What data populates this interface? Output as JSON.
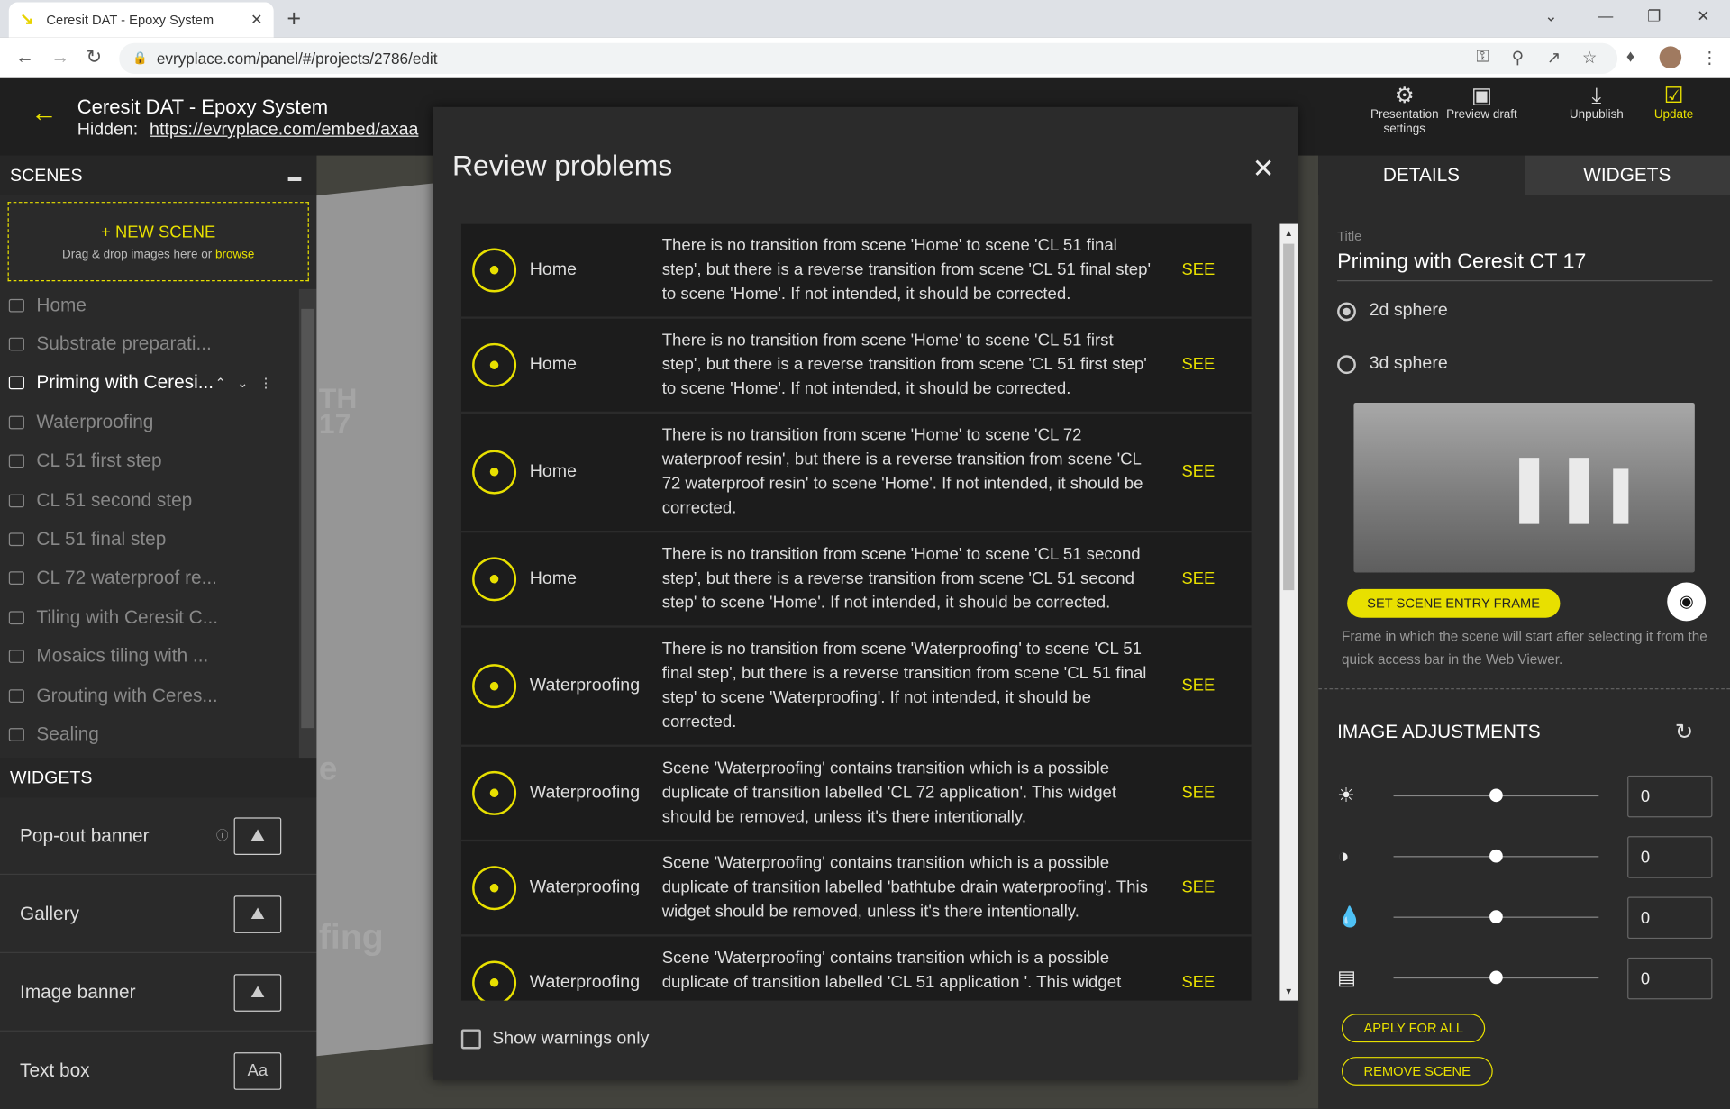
{
  "browser": {
    "tab_title": "Ceresit DAT - Epoxy System",
    "url": "evryplace.com/panel/#/projects/2786/edit"
  },
  "header": {
    "project_title": "Ceresit DAT - Epoxy System",
    "hidden_label": "Hidden:",
    "hidden_link": "https://evryplace.com/embed/axaa",
    "buttons": {
      "presentation_settings": "Presentation settings",
      "preview_draft": "Preview draft",
      "unpublish": "Unpublish",
      "update": "Update"
    }
  },
  "scenes_panel": {
    "title": "SCENES",
    "new_scene": "NEW SCENE",
    "drag_text": "Drag & drop images here or",
    "browse": "browse",
    "items": [
      {
        "label": "Home"
      },
      {
        "label": "Substrate preparati..."
      },
      {
        "label": "Priming with Ceresi..."
      },
      {
        "label": "Waterproofing"
      },
      {
        "label": "CL 51 first step"
      },
      {
        "label": "CL 51 second step"
      },
      {
        "label": "CL 51 final step"
      },
      {
        "label": "CL 72 waterproof re..."
      },
      {
        "label": "Tiling with Ceresit C..."
      },
      {
        "label": "Mosaics tiling with ..."
      },
      {
        "label": "Grouting with Ceres..."
      },
      {
        "label": "Sealing"
      }
    ],
    "selected_index": 2
  },
  "widgets_panel": {
    "title": "WIDGETS",
    "items": [
      {
        "label": "Pop-out banner"
      },
      {
        "label": "Gallery"
      },
      {
        "label": "Image banner"
      },
      {
        "label": "Text box",
        "icon_text": "Aa"
      }
    ]
  },
  "modal": {
    "title": "Review problems",
    "see_label": "SEE",
    "problems": [
      {
        "scene": "Home",
        "message": "There is no transition from scene 'Home' to scene 'CL 51 final step', but there is a reverse transition from scene 'CL 51 final step' to scene 'Home'. If not intended, it should be corrected."
      },
      {
        "scene": "Home",
        "message": "There is no transition from scene 'Home' to scene 'CL 51 first step', but there is a reverse transition from scene 'CL 51 first step' to scene 'Home'. If not intended, it should be corrected."
      },
      {
        "scene": "Home",
        "message": "There is no transition from scene 'Home' to scene 'CL 72 waterproof resin', but there is a reverse transition from scene 'CL 72 waterproof resin' to scene 'Home'. If not intended, it should be corrected."
      },
      {
        "scene": "Home",
        "message": "There is no transition from scene 'Home' to scene 'CL 51 second step', but there is a reverse transition from scene 'CL 51 second step' to scene 'Home'. If not intended, it should be corrected."
      },
      {
        "scene": "Waterproofing",
        "message": "There is no transition from scene 'Waterproofing' to scene 'CL 51 final step', but there is a reverse transition from scene 'CL 51 final step' to scene 'Waterproofing'. If not intended, it should be corrected."
      },
      {
        "scene": "Waterproofing",
        "message": "Scene 'Waterproofing' contains transition which is a possible duplicate of transition labelled 'CL 72 application'. This widget should be removed, unless it's there intentionally."
      },
      {
        "scene": "Waterproofing",
        "message": "Scene 'Waterproofing' contains transition which is a possible duplicate of transition labelled 'bathtube drain waterproofing'. This widget should be removed, unless it's there intentionally."
      },
      {
        "scene": "Waterproofing",
        "message": "Scene 'Waterproofing' contains transition which is a possible duplicate of transition labelled 'CL 51 application '. This widget"
      }
    ],
    "show_warnings_only": "Show warnings only"
  },
  "details_panel": {
    "tab_details": "DETAILS",
    "tab_widgets": "WIDGETS",
    "title_label": "Title",
    "title_value": "Priming with Ceresit CT 17",
    "sphere_2d": "2d sphere",
    "sphere_3d": "3d sphere",
    "set_entry_frame": "SET SCENE ENTRY FRAME",
    "frame_description": "Frame in which the scene will start after selecting it from the quick access bar in the Web Viewer.",
    "image_adjustments": "IMAGE ADJUSTMENTS",
    "adjustments": [
      {
        "icon": "brightness-icon",
        "value": "0"
      },
      {
        "icon": "contrast-icon",
        "value": "0"
      },
      {
        "icon": "saturation-icon",
        "value": "0"
      },
      {
        "icon": "exposure-icon",
        "value": "0"
      }
    ],
    "apply_for_all": "APPLY FOR ALL",
    "remove_scene": "REMOVE SCENE"
  },
  "background_scene": {
    "labels": [
      "TH",
      "17",
      "e",
      "fing"
    ]
  },
  "colors": {
    "accent": "#e8e000",
    "panel": "#2b2b2b"
  }
}
